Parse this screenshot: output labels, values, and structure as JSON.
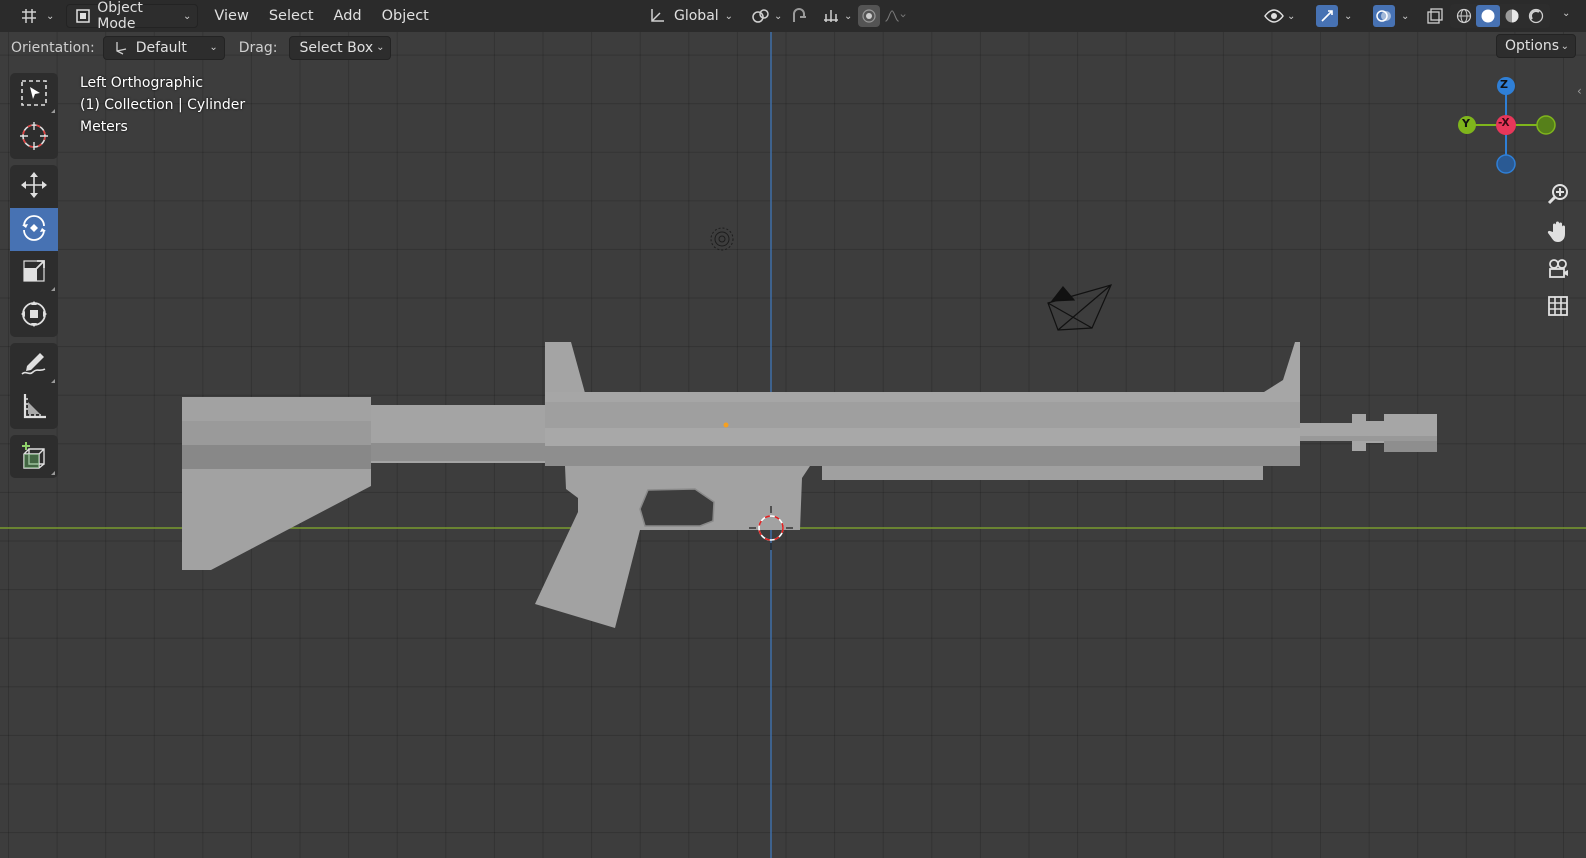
{
  "header": {
    "mode_label": "Object Mode",
    "menus": [
      "View",
      "Select",
      "Add",
      "Object"
    ],
    "transform_orientation": "Global"
  },
  "tool_settings": {
    "orientation_label": "Orientation:",
    "orientation_value": "Default",
    "drag_label": "Drag:",
    "drag_value": "Select Box",
    "options_label": "Options"
  },
  "viewport_info": {
    "view_name": "Left Orthographic",
    "collection_line": "(1) Collection | Cylinder",
    "units": "Meters"
  },
  "gizmo": {
    "z_label": "Z",
    "y_label": "Y",
    "x_label": "-X",
    "z_color": "#2f7fd6",
    "y_color": "#7fb51c",
    "x_color": "#e8375a"
  },
  "toolbar": {
    "active_tool": "rotate",
    "tools": [
      "select-box",
      "cursor",
      "move",
      "rotate",
      "scale",
      "transform",
      "annotate",
      "measure",
      "add-cube"
    ]
  },
  "colors": {
    "accent": "#4772b3",
    "axis_x_line": "#7a9c2e",
    "axis_z_line": "#3e6ea8",
    "mesh_light": "#a4a4a4",
    "mesh_dark": "#8a8a8a"
  }
}
